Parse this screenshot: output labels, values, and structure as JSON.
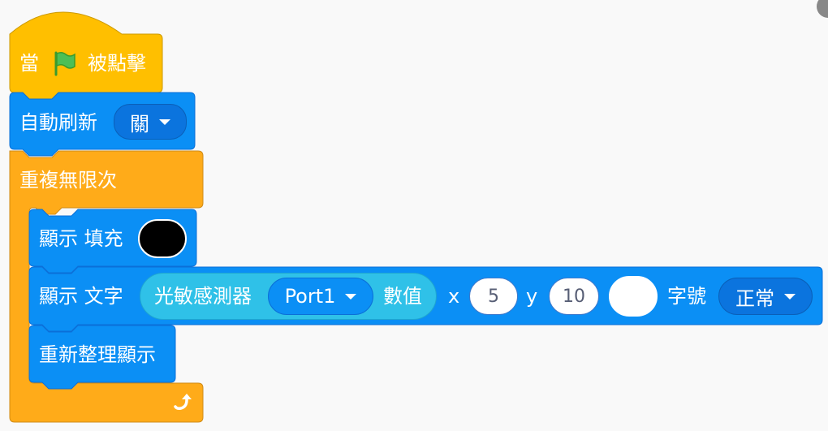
{
  "colors": {
    "events": "#ffbf00",
    "events_border": "#cc9900",
    "control": "#ffab19",
    "control_border": "#cf8b17",
    "ext": "#0fbd8c",
    "blue": "#0b8ff5",
    "blue_border": "#0b6fd8",
    "blue_dark": "#0b74de",
    "reporter": "#2fc1e8",
    "reporter_border": "#1fa6d0"
  },
  "hat": {
    "when": "當",
    "flag_icon": "green-flag-icon",
    "clicked": "被點擊"
  },
  "auto_refresh": {
    "label": "自動刷新",
    "value": "關"
  },
  "forever": {
    "label": "重複無限次",
    "loop_icon": "loop-arrow-icon"
  },
  "fill": {
    "label": "顯示 填充",
    "color": "#000000"
  },
  "text_block": {
    "label": "顯示 文字",
    "reporter_label": "光敏感測器",
    "port": "Port1",
    "value_label": "數值",
    "x_label": "x",
    "x_value": "5",
    "y_label": "y",
    "y_value": "10",
    "color_value": "#ffffff",
    "size_label": "字號",
    "size_value": "正常"
  },
  "refresh": {
    "label": "重新整理顯示"
  }
}
